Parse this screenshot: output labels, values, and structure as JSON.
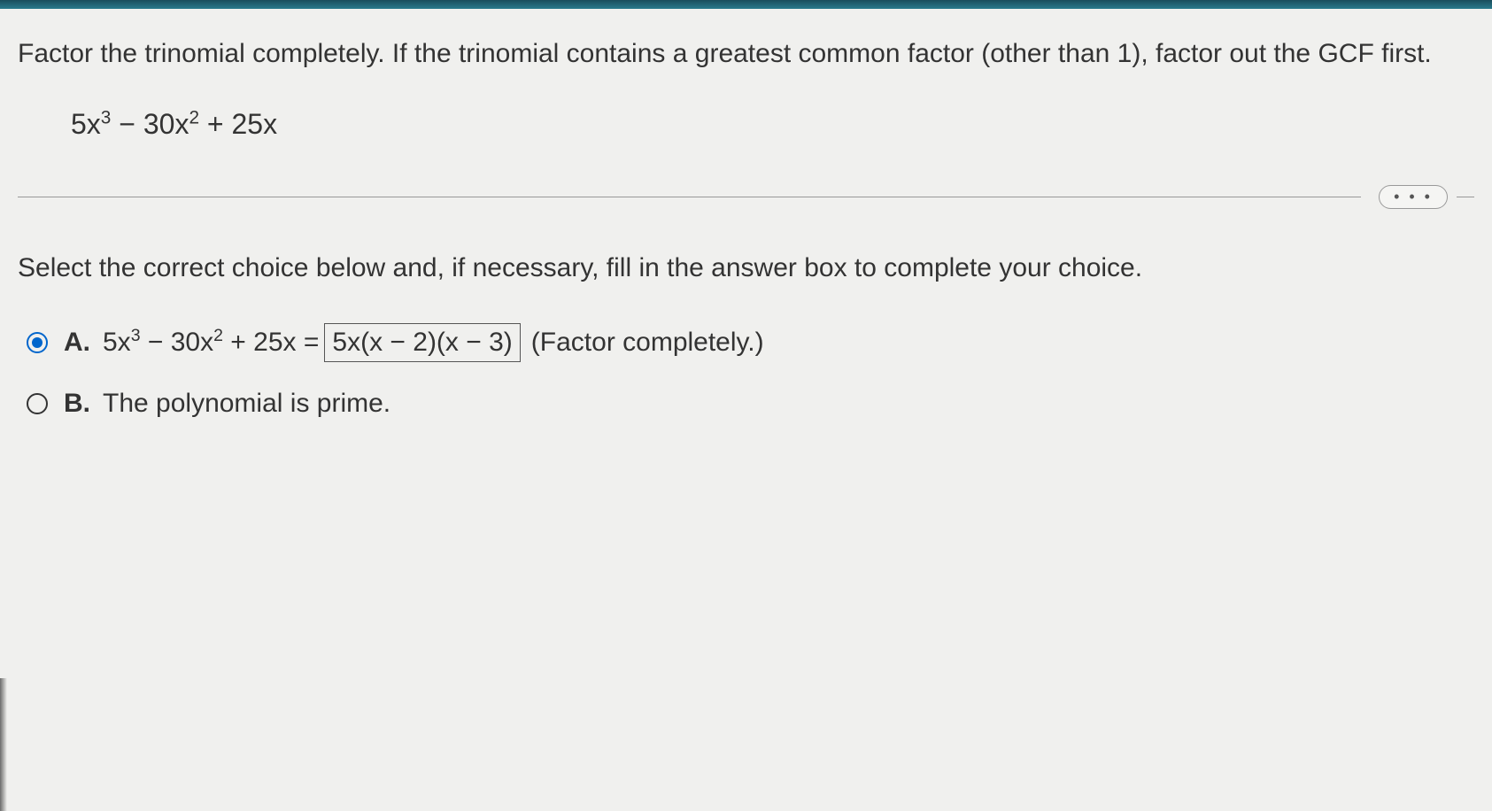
{
  "question": {
    "prompt": "Factor the trinomial completely. If the trinomial contains a greatest common factor (other than 1), factor out the GCF first.",
    "expression_html": "5x<sup>3</sup> − 30x<sup>2</sup> + 25x"
  },
  "instruction": "Select the correct choice below and, if necessary, fill in the answer box to complete your choice.",
  "more_dots": "• • •",
  "choices": {
    "a": {
      "label": "A.",
      "lhs_html": "5x<sup>3</sup> − 30x<sup>2</sup> + 25x =",
      "answer": "5x(x − 2)(x − 3)",
      "hint": "(Factor completely.)",
      "selected": true
    },
    "b": {
      "label": "B.",
      "text": "The polynomial is prime.",
      "selected": false
    }
  }
}
